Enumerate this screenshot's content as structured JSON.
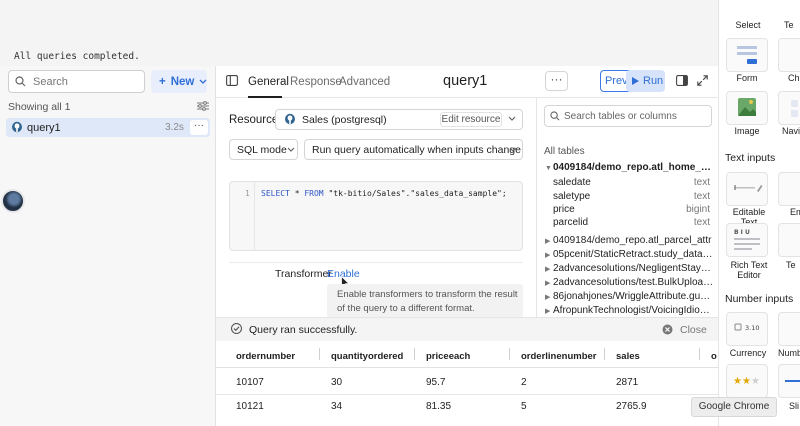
{
  "status_line": "All queries completed.",
  "left_panel": {
    "search_placeholder": "Search",
    "new_label": "New",
    "showing_label": "Showing all 1",
    "query_item": {
      "name": "query1",
      "time": "3.2s",
      "more": "···"
    }
  },
  "header": {
    "tabs": [
      "General",
      "Response",
      "Advanced"
    ],
    "title": "query1",
    "more": "···",
    "preview_label": "Preview",
    "run_label": "Run"
  },
  "editor": {
    "resource_label": "Resource",
    "resource_name": "Sales (postgresql)",
    "edit_resource_label": "Edit resource",
    "mode": "SQL mode",
    "run_behavior": "Run query automatically when inputs change",
    "line_number": "1",
    "code": {
      "select": "SELECT",
      "star": " * ",
      "from": "FROM",
      "table": " \"tk-bitio/Sales\".\"sales_data_sample\";"
    },
    "transformer_label": "Transformer",
    "transformer_enable": "Enable",
    "transformer_help_1": "Enable transformers to transform the result",
    "transformer_help_2": "of the query to a different format."
  },
  "schema": {
    "search_placeholder": "Search tables or columns",
    "all_tables_label": "All tables",
    "open_table": "0409184/demo_repo.atl_home_sales",
    "columns": [
      {
        "name": "saledate",
        "type": "text"
      },
      {
        "name": "saletype",
        "type": "text"
      },
      {
        "name": "price",
        "type": "bigint"
      },
      {
        "name": "parcelid",
        "type": "text"
      }
    ],
    "tables": [
      "0409184/demo_repo.atl_parcel_attr",
      "05pcenit/StaticRetract.study_data_2...",
      "2advancesolutions/NegligentStays.B...",
      "2advancesolutions/test.BulkUpload (5)",
      "86jonahjones/WriggleAttribute.guest...",
      "AfropunkTechnologist/VoicingIdiom.c..."
    ]
  },
  "result": {
    "success_text": "Query ran successfully.",
    "close_label": "Close",
    "columns": [
      "ordernumber",
      "quantityordered",
      "priceeach",
      "orderlinenumber",
      "sales",
      "o"
    ],
    "rows": [
      [
        "10107",
        "30",
        "95.7",
        "2",
        "2871"
      ],
      [
        "10121",
        "34",
        "81.35",
        "5",
        "2765.9"
      ]
    ]
  },
  "tooltip": "Google Chrome",
  "components": {
    "top_labels": [
      "Select",
      "Te"
    ],
    "row1": [
      "Form",
      "Ch"
    ],
    "row2": [
      "Image",
      "Navig"
    ],
    "section_text": "Text inputs",
    "row3": [
      "Editable Text",
      "Em"
    ],
    "row4_left_1": "Rich Text",
    "row4_left_2": "Editor",
    "row4_right": "Te",
    "section_number": "Number inputs",
    "row5": [
      "Currency",
      "Numbe"
    ],
    "row6": [
      "Sli"
    ],
    "currency_sample": "3.10"
  },
  "colors": {
    "accent": "#2f6fd6",
    "selected_row": "#dfe8f8",
    "success": "#5b8a5b"
  }
}
